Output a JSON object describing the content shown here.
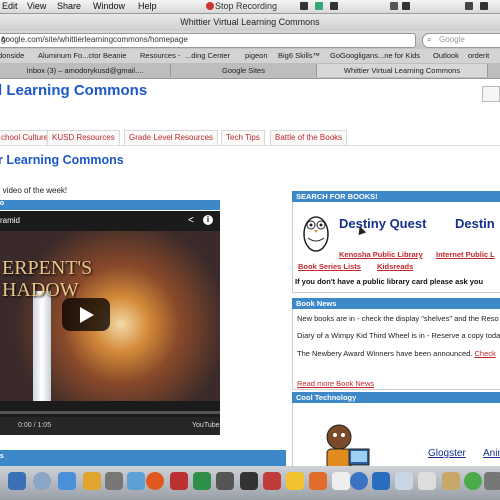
{
  "menubar": {
    "items": [
      "Edit",
      "View",
      "Share",
      "Window",
      "Help"
    ],
    "stop_recording": "Stop Recording"
  },
  "window": {
    "title": "Whittier Virtual Learning Commons"
  },
  "toolbar": {
    "url": "google.com/site/whittierlearningcommons/homepage",
    "search_placeholder": "Google"
  },
  "bookmarks": [
    "donside",
    "Aluminum Fo...ctor Beanie",
    "Resources -",
    "...ding Center",
    "pigeon",
    "Big6 Skills™",
    "GoGoogligans...ne for Kids",
    "Outlook",
    "orderit"
  ],
  "tabs": [
    {
      "label": "Inbox (3) – amodorykusd@gmail...."
    },
    {
      "label": "Google Sites"
    },
    {
      "label": "Whittier Virtual Learning Commons"
    }
  ],
  "site": {
    "title": "l Learning Commons",
    "nav": [
      "chool Culture",
      "KUSD Resources",
      "Grade Level Resources",
      "Tech Tips",
      "Battle of the Books"
    ]
  },
  "main": {
    "heading": "r Learning Commons",
    "intro": "e video of the week!"
  },
  "video": {
    "header": "eo",
    "title": "yramid",
    "art_text": "ERPENT'S\nHADOW",
    "time": "0:00 / 1:05",
    "logo": "YouTube"
  },
  "next_section": {
    "header": "es"
  },
  "search_books": {
    "header": "SEARCH FOR BOOKS!",
    "destiny_label": "Destiny Quest",
    "destiny_label_2": "Destin",
    "links": [
      "Kenosha Public Library",
      "Internet Public L",
      "Book Series Lists",
      "Kidsreads"
    ],
    "note": "If you don't have a public library card please ask you"
  },
  "book_news": {
    "header": "Book News",
    "items": [
      {
        "text": "New books are in - check the display \"shelves\" and the Reso"
      },
      {
        "text": "Diary of a Wimpy Kid Third Wheel is in - Reserve a copy toda"
      },
      {
        "text": "The Newbery Award Winners have been announced.",
        "link": "Check"
      }
    ],
    "read_more": "Read more Book News"
  },
  "cool_tech": {
    "header": "Cool Technology",
    "links": [
      "Glogster",
      "Animo"
    ]
  },
  "colors": {
    "accent": "#3c88c9",
    "title": "#1d57c9",
    "link_red": "#c0282d",
    "dark_blue": "#16318d"
  }
}
